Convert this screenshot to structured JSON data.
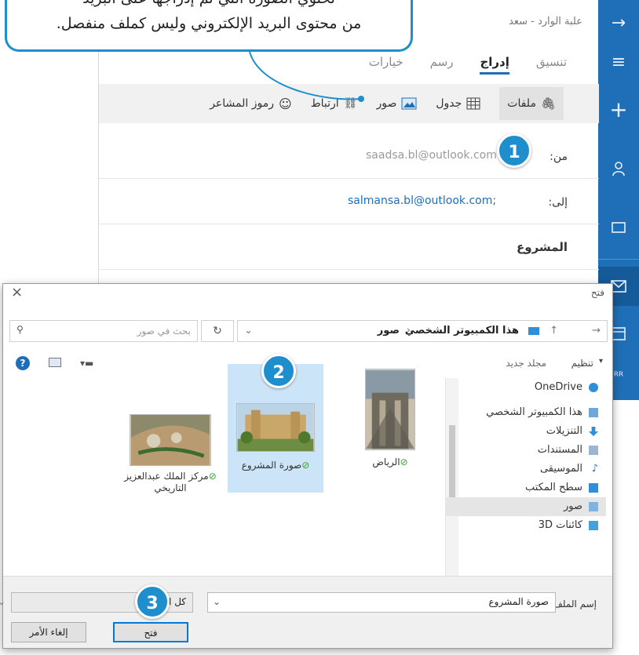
{
  "callout": {
    "line1": "تحتوي الصورة التي تم إدراجها على البريد",
    "line2": "من محتوى البريد الإلكتروني وليس كملف منفصل."
  },
  "steps": {
    "one": "1",
    "two": "2",
    "three": "3"
  },
  "mail": {
    "crumb": "علبة الوارد - سعد",
    "tabs": [
      "تنسيق",
      "إدراج",
      "رسم",
      "خيارات"
    ],
    "toolbar": [
      "ملفات",
      "جدول",
      "صور",
      "ارتباط",
      "رموز المشاعر"
    ],
    "from_label": "من:",
    "from_value": "saadsa.bl@outlook.com",
    "to_label": "إلى:",
    "to_value": "salmansa.bl@outlook.com;",
    "subject": "المشروع"
  },
  "dialog": {
    "title": "فتح",
    "close": "×",
    "address": {
      "folder": "صور",
      "parent": "هذا الكمبيوتر الشخصي"
    },
    "search_placeholder": "بحث في صور",
    "organize": "تنظيم",
    "new_folder": "مجلد جديد",
    "nav": [
      "OneDrive",
      "هذا الكمبيوتر الشخصي",
      "التنزيلات",
      "المستندات",
      "الموسيقى",
      "سطح المكتب",
      "صور",
      "كائنات 3D"
    ],
    "files": [
      {
        "name": "الرياض"
      },
      {
        "name": "صورة المشروع"
      },
      {
        "name": "مركز الملك عبدالعزيز التاريخي"
      }
    ],
    "filename_label": "إسم الملف:",
    "filename_value": "صورة المشروع",
    "filetype": "كل الملفات",
    "open_button": "فتح",
    "cancel_button": "إلغاء الأمر"
  },
  "colors": {
    "accent": "#1e8fcc",
    "rail": "#1f6fb8",
    "selection": "#cce4f7"
  }
}
